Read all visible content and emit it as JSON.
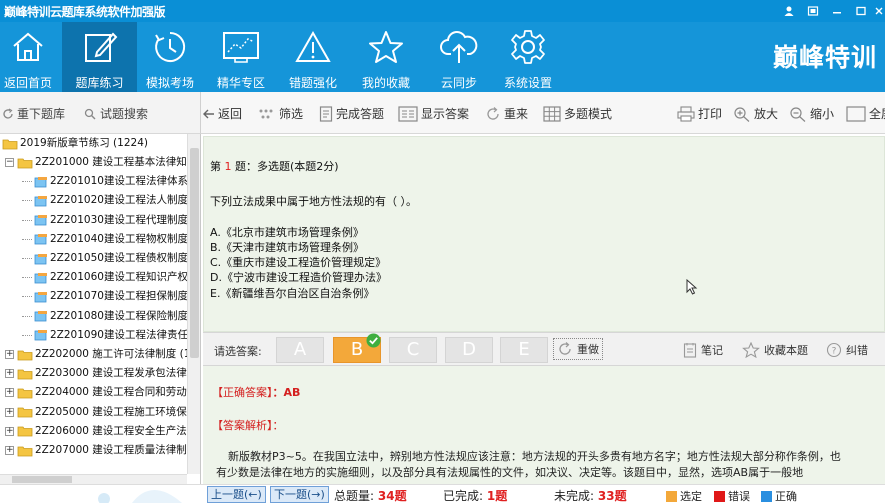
{
  "app": {
    "title": "巅峰特训云题库系统软件加强版",
    "brand": "巅峰特训"
  },
  "ribbon": [
    {
      "label": "返回首页",
      "icon": "home-icon"
    },
    {
      "label": "题库练习",
      "icon": "edit-icon"
    },
    {
      "label": "模拟考场",
      "icon": "clock-icon"
    },
    {
      "label": "精华专区",
      "icon": "chart-icon"
    },
    {
      "label": "错题强化",
      "icon": "warning-icon"
    },
    {
      "label": "我的收藏",
      "icon": "star-icon"
    },
    {
      "label": "云同步",
      "icon": "cloud-upload-icon"
    },
    {
      "label": "系统设置",
      "icon": "gear-icon"
    }
  ],
  "left_toolbar": {
    "reload": "重下题库",
    "search": "试题搜索"
  },
  "tree": {
    "root": "2019新版章节练习 (1224)",
    "nodes": [
      {
        "label": "2Z201000 建设工程基本法律知"
      },
      {
        "label": "2Z201010建设工程法律体系"
      },
      {
        "label": "2Z201020建设工程法人制度"
      },
      {
        "label": "2Z201030建设工程代理制度"
      },
      {
        "label": "2Z201040建设工程物权制度"
      },
      {
        "label": "2Z201050建设工程债权制度"
      },
      {
        "label": "2Z201060建设工程知识产权"
      },
      {
        "label": "2Z201070建设工程担保制度"
      },
      {
        "label": "2Z201080建设工程保险制度"
      },
      {
        "label": "2Z201090建设工程法律责任"
      },
      {
        "label": "2Z202000 施工许可法律制度 (1"
      },
      {
        "label": "2Z203000 建设工程发承包法律"
      },
      {
        "label": "2Z204000 建设工程合同和劳动"
      },
      {
        "label": "2Z205000 建设工程施工环境保"
      },
      {
        "label": "2Z206000 建设工程安全生产法"
      },
      {
        "label": "2Z207000 建设工程质量法律制"
      }
    ]
  },
  "main_toolbar": {
    "back": "返回",
    "filter": "筛选",
    "finish": "完成答题",
    "show_answer": "显示答案",
    "redo": "重来",
    "multi": "多题模式",
    "print": "打印",
    "zoom_in": "放大",
    "zoom_out": "缩小",
    "fullscreen": "全屏"
  },
  "question": {
    "prefix": "第",
    "number": "1",
    "suffix": "题：多选题(本题2分)",
    "stem": "下列立法成果中属于地方性法规的有（ ）。",
    "options": [
      "A.《北京市建筑市场管理条例》",
      "B.《天津市建筑市场管理条例》",
      "C.《重庆市建设工程造价管理规定》",
      "D.《宁波市建设工程造价管理办法》",
      "E.《新疆维吾尔自治区自治条例》"
    ]
  },
  "answer_bar": {
    "label": "请选答案:",
    "choices": [
      "A",
      "B",
      "C",
      "D",
      "E"
    ],
    "selected": [
      "B"
    ],
    "redo": "重做",
    "note": "笔记",
    "fav": "收藏本题",
    "report": "纠错"
  },
  "explanation": {
    "correct_label": "【正确答案】",
    "correct_value": "：AB",
    "analysis_label": "【答案解析】：",
    "line1": "新版教材P3~5。在我国立法中，辨别地方性法规应该注意：地方法规的开头多贵有地方名字；地方性法规大部分称作条例，也",
    "line2": "有少数是法律在地方的实施细则，以及部分具有法规属性的文件，如决议、决定等。该题目中，显然，选项AB属于一般地"
  },
  "bottom": {
    "prev": "上一题(←)",
    "next": "下一题(→)",
    "total_label": "总题量:",
    "total_value": "34题",
    "done_label": "已完成:",
    "done_value": "1题",
    "undone_label": "未完成:",
    "undone_value": "33题",
    "legend": [
      {
        "label": "选定",
        "color": "#f3a83a"
      },
      {
        "label": "错误",
        "color": "#e01818"
      },
      {
        "label": "正确",
        "color": "#2a8fe0"
      }
    ]
  }
}
